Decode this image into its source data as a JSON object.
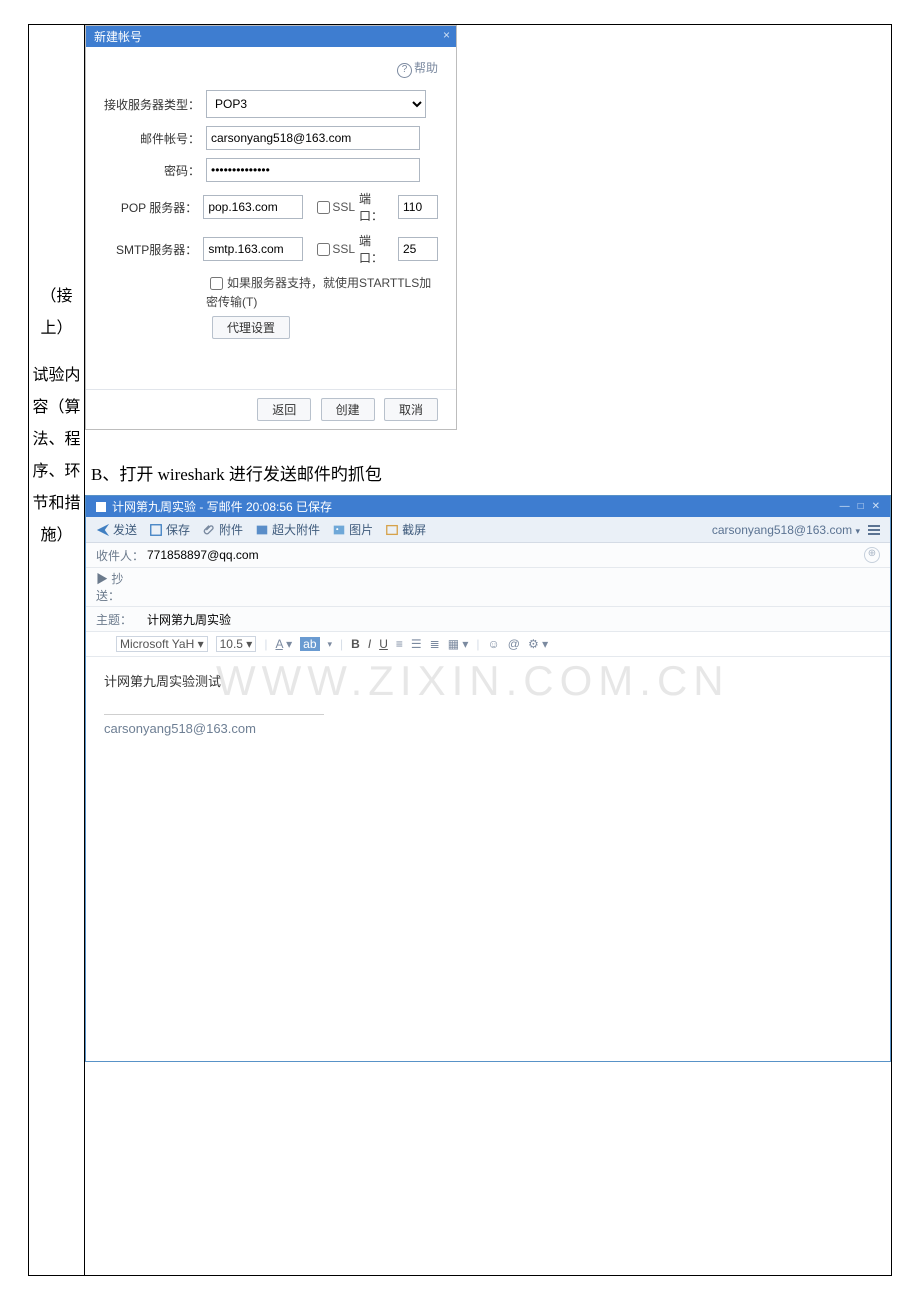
{
  "left_label_upper": "（接上）",
  "left_label_lower": "试验内容（算法、程序、环节和措施）",
  "dialog1": {
    "title": "新建帐号",
    "help": "帮助",
    "labels": {
      "server_type": "接收服务器类型：",
      "account": "邮件帐号：",
      "password": "密码：",
      "pop": "POP 服务器：",
      "smtp": "SMTP服务器："
    },
    "server_type_value": "POP3",
    "account_value": "carsonyang518@163.com",
    "password_value": "••••••••••••••",
    "pop_server": "pop.163.com",
    "pop_port": "110",
    "smtp_server": "smtp.163.com",
    "smtp_port": "25",
    "ssl_label": "SSL",
    "port_label": "端口：",
    "starttls_label": "如果服务器支持，就使用STARTTLS加密传输(T)",
    "proxy_btn": "代理设置",
    "buttons": {
      "back": "返回",
      "create": "创建",
      "cancel": "取消"
    }
  },
  "sectionB_text": "B、打开 wireshark 进行发送邮件旳抓包",
  "compose": {
    "window_title": "计网第九周实验 - 写邮件   20:08:56 已保存",
    "toolbar": {
      "send": "发送",
      "save": "保存",
      "attach": "附件",
      "big_attach": "超大附件",
      "image": "图片",
      "screenshot": "截屏"
    },
    "account_selector": "carsonyang518@163.com",
    "headers": {
      "to_label": "收件人：",
      "to_value": "771858897@qq.com",
      "cc_label": "▶ 抄送：",
      "cc_value": "",
      "subject_label": "主题：",
      "subject_value": "计网第九周实验"
    },
    "format": {
      "font": "Microsoft YaH",
      "size": "10.5"
    },
    "body": "计网第九周实验测试",
    "signature": "carsonyang518@163.com",
    "watermark": "WWW.ZIXIN.COM.CN"
  }
}
